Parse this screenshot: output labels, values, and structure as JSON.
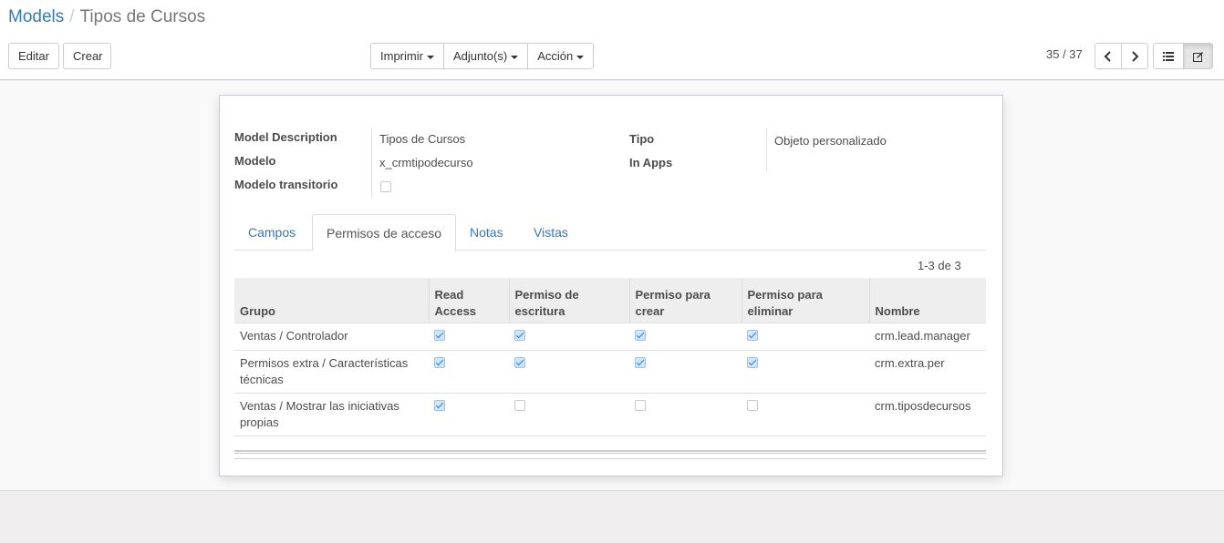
{
  "breadcrumb": {
    "parent": "Models",
    "separator": "/",
    "current": "Tipos de Cursos"
  },
  "toolbar": {
    "edit_label": "Editar",
    "create_label": "Crear",
    "print_label": "Imprimir",
    "attachment_label": "Adjunto(s)",
    "action_label": "Acción"
  },
  "pager": {
    "value": "35 / 37"
  },
  "form": {
    "model_description_label": "Model Description",
    "model_description_value": "Tipos de Cursos",
    "model_label": "Modelo",
    "model_value": "x_crmtipodecurso",
    "transient_label": "Modelo transitorio",
    "transient_checked": false,
    "type_label": "Tipo",
    "type_value": "Objeto personalizado",
    "in_apps_label": "In Apps"
  },
  "tabs": [
    "Campos",
    "Permisos de acceso",
    "Notas",
    "Vistas"
  ],
  "active_tab": "Permisos de acceso",
  "table": {
    "count": "1-3 de 3",
    "headers": [
      "Grupo",
      "Read Access",
      "Permiso de escritura",
      "Permiso para crear",
      "Permiso para eliminar",
      "Nombre"
    ],
    "rows": [
      {
        "group": "Ventas / Controlador",
        "read": true,
        "write": true,
        "create": true,
        "unlink": true,
        "name": "crm.lead.manager"
      },
      {
        "group": "Permisos extra / Características técnicas",
        "read": true,
        "write": true,
        "create": true,
        "unlink": true,
        "name": "crm.extra.per"
      },
      {
        "group": "Ventas / Mostrar las iniciativas propias",
        "read": true,
        "write": false,
        "create": false,
        "unlink": false,
        "name": "crm.tiposdecursos"
      }
    ]
  },
  "colors": {
    "link": "#337ab7",
    "checkbox_checked": "#cfe6fa"
  }
}
